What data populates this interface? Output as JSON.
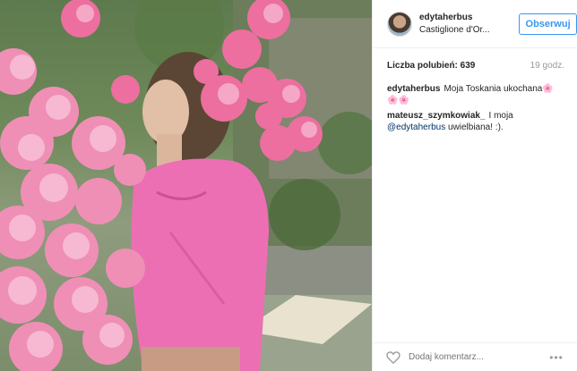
{
  "photo": {
    "alt_icon": "post-photo"
  },
  "header": {
    "username": "edytaherbus",
    "location": "Castiglione d'Or...",
    "follow_label": "Obserwuj"
  },
  "stats": {
    "likes": "Liczba polubień: 639",
    "time": "19 godz."
  },
  "comments": [
    {
      "user": "edytaherbus",
      "text": "Moja Toskania ukochana🌸🌸🌸",
      "mention": "",
      "after": ""
    },
    {
      "user": "mateusz_szymkowiak_",
      "text": "I moja",
      "mention": "@edytaherbus",
      "after": "uwielbiana! :)."
    }
  ],
  "footer": {
    "placeholder": "Dodaj komentarz...",
    "more_label": "•••"
  },
  "colors": {
    "accent": "#3897f0",
    "mention": "#003569"
  }
}
